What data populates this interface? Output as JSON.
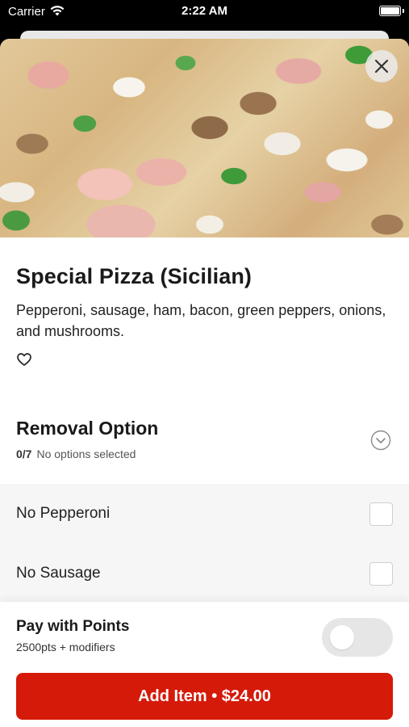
{
  "status_bar": {
    "carrier": "Carrier",
    "time": "2:22 AM"
  },
  "item": {
    "title": "Special Pizza (Sicilian)",
    "description": "Pepperoni, sausage, ham, bacon, green peppers, onions, and mushrooms.",
    "favorited": false
  },
  "removal_option": {
    "title": "Removal Option",
    "count": "0/7",
    "status": "No options selected",
    "options": [
      {
        "label": "No Pepperoni",
        "checked": false
      },
      {
        "label": "No Sausage",
        "checked": false
      }
    ]
  },
  "points": {
    "title": "Pay with Points",
    "subtitle": "2500pts + modifiers",
    "enabled": false
  },
  "add_button": {
    "label": "Add Item • $24.00"
  },
  "colors": {
    "accent": "#d51a0a",
    "toggle_off": "#e6e6e6"
  },
  "icons": [
    "wifi-icon",
    "battery-icon",
    "close-icon",
    "heart-icon",
    "chevron-down-icon"
  ]
}
